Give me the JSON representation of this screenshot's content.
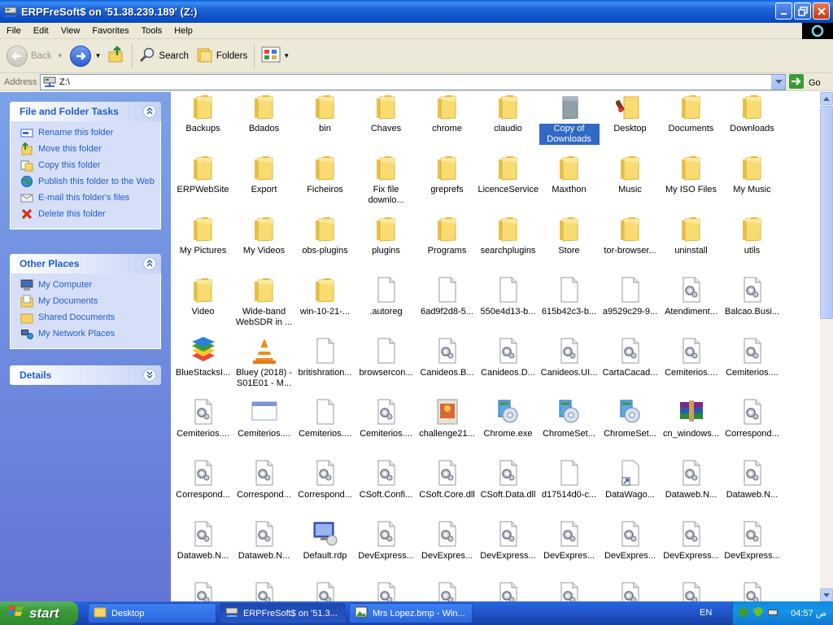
{
  "window": {
    "title": "ERPFreSoft$ on '51.38.239.189' (Z:)"
  },
  "menu": [
    "File",
    "Edit",
    "View",
    "Favorites",
    "Tools",
    "Help"
  ],
  "toolbar": {
    "back_label": "Back",
    "search_label": "Search",
    "folders_label": "Folders"
  },
  "address": {
    "label": "Address",
    "value": "Z:\\",
    "go_label": "Go"
  },
  "left_panels": {
    "tasks": {
      "title": "File and Folder Tasks",
      "items": [
        {
          "label": "Rename this folder",
          "icon": "rename-icon"
        },
        {
          "label": "Move this folder",
          "icon": "move-icon"
        },
        {
          "label": "Copy this folder",
          "icon": "copy-icon"
        },
        {
          "label": "Publish this folder to the Web",
          "icon": "publish-icon"
        },
        {
          "label": "E-mail this folder's files",
          "icon": "email-icon"
        },
        {
          "label": "Delete this folder",
          "icon": "delete-icon"
        }
      ]
    },
    "places": {
      "title": "Other Places",
      "items": [
        {
          "label": "My Computer",
          "icon": "computer-icon"
        },
        {
          "label": "My Documents",
          "icon": "documents-icon"
        },
        {
          "label": "Shared Documents",
          "icon": "shared-folder-icon"
        },
        {
          "label": "My Network Places",
          "icon": "network-icon"
        }
      ]
    },
    "details": {
      "title": "Details"
    }
  },
  "files": [
    {
      "name": "Backups",
      "type": "folder"
    },
    {
      "name": "Bdados",
      "type": "folder"
    },
    {
      "name": "bin",
      "type": "folder"
    },
    {
      "name": "Chaves",
      "type": "folder"
    },
    {
      "name": "chrome",
      "type": "folder"
    },
    {
      "name": "claudio",
      "type": "folder"
    },
    {
      "name": "Copy of Downloads",
      "type": "folder-gray",
      "selected": true
    },
    {
      "name": "Desktop",
      "type": "folder-special"
    },
    {
      "name": "Documents",
      "type": "folder"
    },
    {
      "name": "Downloads",
      "type": "folder"
    },
    {
      "name": "ERPWebSite",
      "type": "folder"
    },
    {
      "name": "Export",
      "type": "folder"
    },
    {
      "name": "Ficheiros",
      "type": "folder"
    },
    {
      "name": "Fix file downlo...",
      "type": "folder"
    },
    {
      "name": "greprefs",
      "type": "folder"
    },
    {
      "name": "LicenceService",
      "type": "folder"
    },
    {
      "name": "Maxthon",
      "type": "folder"
    },
    {
      "name": "Music",
      "type": "folder"
    },
    {
      "name": "My ISO Files",
      "type": "folder"
    },
    {
      "name": "My Music",
      "type": "folder"
    },
    {
      "name": "My Pictures",
      "type": "folder"
    },
    {
      "name": "My Videos",
      "type": "folder"
    },
    {
      "name": "obs-plugins",
      "type": "folder"
    },
    {
      "name": "plugins",
      "type": "folder"
    },
    {
      "name": "Programs",
      "type": "folder"
    },
    {
      "name": "searchplugins",
      "type": "folder"
    },
    {
      "name": "Store",
      "type": "folder"
    },
    {
      "name": "tor-browser...",
      "type": "folder"
    },
    {
      "name": "uninstall",
      "type": "folder"
    },
    {
      "name": "utils",
      "type": "folder"
    },
    {
      "name": "Video",
      "type": "folder"
    },
    {
      "name": "Wide-band WebSDR in ...",
      "type": "folder"
    },
    {
      "name": "win-10-21-...",
      "type": "folder"
    },
    {
      "name": ".autoreg",
      "type": "file"
    },
    {
      "name": "6ad9f2d8-5...",
      "type": "file"
    },
    {
      "name": "550e4d13-b...",
      "type": "file"
    },
    {
      "name": "615b42c3-b...",
      "type": "file"
    },
    {
      "name": "a9529c29-9...",
      "type": "file"
    },
    {
      "name": "Atendiment...",
      "type": "dll"
    },
    {
      "name": "Balcao.Busi...",
      "type": "dll"
    },
    {
      "name": "BlueStacksI...",
      "type": "bluestacks"
    },
    {
      "name": "Bluey (2018) - S01E01 - M...",
      "type": "vlc"
    },
    {
      "name": "britishration...",
      "type": "file"
    },
    {
      "name": "browsercon...",
      "type": "file"
    },
    {
      "name": "Canideos.B...",
      "type": "dll"
    },
    {
      "name": "Canideos.D...",
      "type": "dll"
    },
    {
      "name": "Canideos.UI...",
      "type": "dll"
    },
    {
      "name": "CartaCacad...",
      "type": "dll"
    },
    {
      "name": "Cemiterios....",
      "type": "dll"
    },
    {
      "name": "Cemiterios....",
      "type": "dll"
    },
    {
      "name": "Cemiterios....",
      "type": "dll"
    },
    {
      "name": "Cemiterios....",
      "type": "window"
    },
    {
      "name": "Cemiterios....",
      "type": "file"
    },
    {
      "name": "Cemiterios....",
      "type": "dll"
    },
    {
      "name": "challenge21...",
      "type": "image"
    },
    {
      "name": "Chrome.exe",
      "type": "installer"
    },
    {
      "name": "ChromeSet...",
      "type": "installer"
    },
    {
      "name": "ChromeSet...",
      "type": "installer"
    },
    {
      "name": "cn_windows...",
      "type": "rar"
    },
    {
      "name": "Correspond...",
      "type": "dll"
    },
    {
      "name": "Correspond...",
      "type": "dll"
    },
    {
      "name": "Correspond...",
      "type": "dll"
    },
    {
      "name": "Correspond...",
      "type": "dll"
    },
    {
      "name": "CSoft.Confi...",
      "type": "dll"
    },
    {
      "name": "CSoft.Core.dll",
      "type": "dll"
    },
    {
      "name": "CSoft.Data.dll",
      "type": "dll"
    },
    {
      "name": "d17514d0-c...",
      "type": "file"
    },
    {
      "name": "DataWago...",
      "type": "shortcut"
    },
    {
      "name": "Dataweb.N...",
      "type": "dll"
    },
    {
      "name": "Dataweb.N...",
      "type": "dll"
    },
    {
      "name": "Dataweb.N...",
      "type": "dll"
    },
    {
      "name": "Dataweb.N...",
      "type": "dll"
    },
    {
      "name": "Default.rdp",
      "type": "rdp"
    },
    {
      "name": "DevExpress...",
      "type": "dll"
    },
    {
      "name": "DevExpres...",
      "type": "dll"
    },
    {
      "name": "DevExpress...",
      "type": "dll"
    },
    {
      "name": "DevExpres...",
      "type": "dll"
    },
    {
      "name": "DevExpres...",
      "type": "dll"
    },
    {
      "name": "DevExpress...",
      "type": "dll"
    },
    {
      "name": "DevExpress...",
      "type": "dll"
    },
    {
      "name": "",
      "type": "dll"
    },
    {
      "name": "",
      "type": "dll"
    },
    {
      "name": "",
      "type": "dll"
    },
    {
      "name": "",
      "type": "dll"
    },
    {
      "name": "",
      "type": "dll"
    },
    {
      "name": "",
      "type": "dll"
    },
    {
      "name": "",
      "type": "dll"
    },
    {
      "name": "",
      "type": "dll"
    },
    {
      "name": "",
      "type": "dll"
    },
    {
      "name": "",
      "type": "dll"
    }
  ],
  "taskbar": {
    "start_label": "start",
    "buttons": [
      {
        "label": "Desktop",
        "icon": "folder-icon"
      },
      {
        "label": "ERPFreSoft$ on '51.3...",
        "icon": "network-drive-icon",
        "active": true
      },
      {
        "label": "Mrs Lopez.bmp - Win...",
        "icon": "image-viewer-icon"
      }
    ],
    "language": "EN",
    "clock": "04:57 ص"
  },
  "colors": {
    "title_blue": "#0b4fc7",
    "pane_blue": "#7ba2e7",
    "link_blue": "#215dc6",
    "selection": "#316ac5",
    "folder_yellow": "#f5d565"
  }
}
